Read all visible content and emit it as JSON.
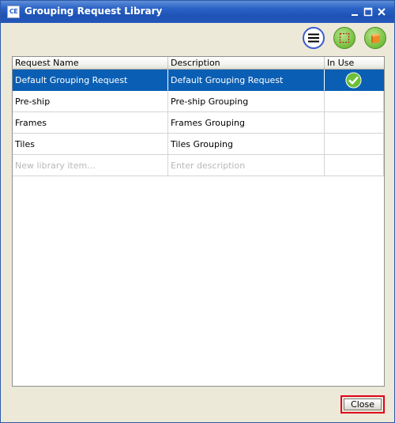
{
  "window": {
    "app_icon_text": "CE",
    "title": "Grouping Request Library"
  },
  "toolbar": {
    "buttons": [
      {
        "icon": "menu-icon"
      },
      {
        "icon": "select-region-icon"
      },
      {
        "icon": "box-icon"
      }
    ]
  },
  "table": {
    "columns": [
      "Request Name",
      "Description",
      "In Use"
    ],
    "rows": [
      {
        "name": "Default Grouping Request",
        "description": "Default Grouping Request",
        "in_use": true,
        "selected": true
      },
      {
        "name": "Pre-ship",
        "description": "Pre-ship Grouping",
        "in_use": false
      },
      {
        "name": "Frames",
        "description": "Frames Grouping",
        "in_use": false
      },
      {
        "name": "Tiles",
        "description": "Tiles Grouping",
        "in_use": false
      }
    ],
    "new_item_placeholder": "New library item...",
    "description_placeholder": "Enter description"
  },
  "footer": {
    "close_label": "Close"
  },
  "colors": {
    "selection": "#0a5fb4",
    "highlight": "#e0001c",
    "accent_green": "#7cc446"
  }
}
